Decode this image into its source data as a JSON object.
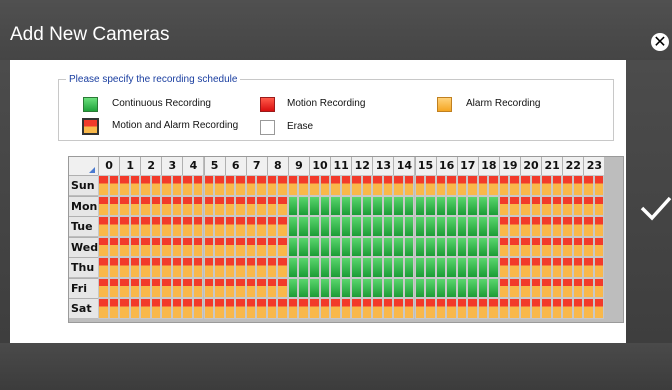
{
  "window": {
    "title": "Add New Cameras"
  },
  "legend_box": {
    "title": "Please specify the recording schedule"
  },
  "legend": [
    {
      "key": "continuous",
      "label": "Continuous Recording",
      "icon": "continuous-swatch",
      "color": "#2bb04a"
    },
    {
      "key": "motion",
      "label": "Motion Recording",
      "icon": "motion-swatch",
      "color": "#e8201a"
    },
    {
      "key": "alarm",
      "label": "Alarm Recording",
      "icon": "alarm-swatch",
      "color": "#f5a623"
    },
    {
      "key": "motion_alarm",
      "label": "Motion and Alarm Recording",
      "icon": "motion-alarm-swatch",
      "color": "#f23a2a"
    },
    {
      "key": "erase",
      "label": "Erase",
      "icon": "erase-swatch",
      "color": "#ffffff"
    }
  ],
  "schedule": {
    "hours": [
      "0",
      "1",
      "2",
      "3",
      "4",
      "5",
      "6",
      "7",
      "8",
      "9",
      "10",
      "11",
      "12",
      "13",
      "14",
      "15",
      "16",
      "17",
      "18",
      "19",
      "20",
      "21",
      "22",
      "23"
    ],
    "days": [
      "Sun",
      "Mon",
      "Tue",
      "Wed",
      "Thu",
      "Fri",
      "Sat"
    ],
    "slots_per_hour": 2,
    "weekday_continuous_hours": [
      9,
      19
    ],
    "weekday_names": [
      "Mon",
      "Tue",
      "Wed",
      "Thu",
      "Fri"
    ],
    "default_mode": "motion_alarm",
    "weekday_mode": "continuous"
  },
  "nav": {
    "prev_icon": "chevron-left-icon",
    "next_icon": "checkmark-icon",
    "close_icon": "close-icon"
  }
}
